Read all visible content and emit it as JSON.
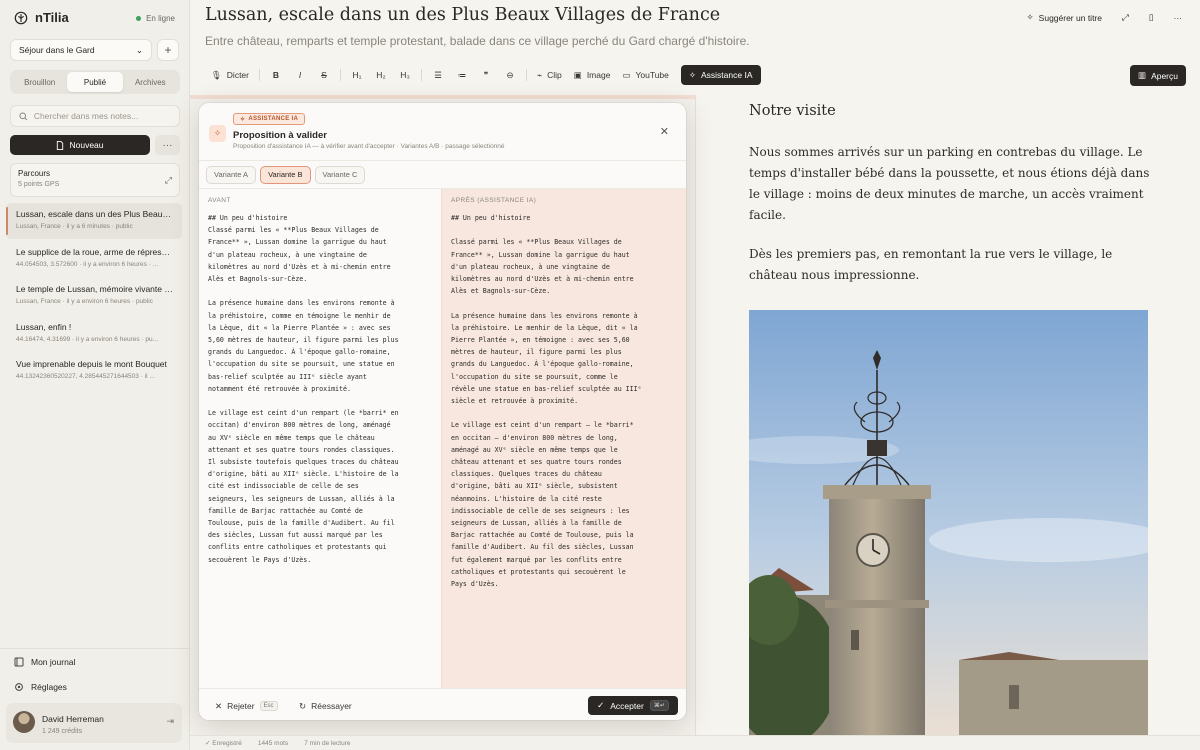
{
  "app": {
    "name": "nTilia",
    "status": "En ligne"
  },
  "sidebar": {
    "trip": "Séjour dans le Gard",
    "tabs": [
      {
        "label": "Brouillon",
        "active": false
      },
      {
        "label": "Publié",
        "active": true
      },
      {
        "label": "Archives",
        "active": false
      }
    ],
    "search_placeholder": "Chercher dans mes notes...",
    "new_label": "Nouveau",
    "parcours": {
      "title": "Parcours",
      "subtitle": "5 points GPS"
    },
    "notes": [
      {
        "title": "Lussan, escale dans un des Plus Beaux ...",
        "meta": "Lussan, France · il y a 6 minutes · public",
        "selected": true
      },
      {
        "title": "Le supplice de la roue, arme de répressi...",
        "meta": "44.054503, 3.572600 · il y a environ 6 heures · ...",
        "selected": false
      },
      {
        "title": "Le temple de Lussan, mémoire vivante d...",
        "meta": "Lussan, France · il y a environ 6 heures · public",
        "selected": false
      },
      {
        "title": "Lussan, enfin !",
        "meta": "44.16474, 4.31699 · il y a environ 6 heures · pu...",
        "selected": false
      },
      {
        "title": "Vue imprenable depuis le mont Bouquet",
        "meta": "44.13242360520227, 4.285445271644503 · il ...",
        "selected": false
      }
    ],
    "journal_label": "Mon journal",
    "settings_label": "Réglages",
    "user": {
      "name": "David Herreman",
      "credits": "1 249 crédits"
    }
  },
  "header": {
    "title": "Lussan, escale dans un des Plus Beaux Villages de France",
    "subtitle": "Entre château, remparts et temple protestant, balade dans ce village perché du Gard chargé d'histoire.",
    "suggest_label": "Suggérer un titre"
  },
  "toolbar": {
    "dictate": "Dicter",
    "bold": "B",
    "italic": "I",
    "strike": "S",
    "h1": "H₁",
    "h2": "H₂",
    "h3": "H₃",
    "clip": "Clip",
    "image": "Image",
    "youtube": "YouTube",
    "ai": "Assistance IA",
    "preview": "Aperçu"
  },
  "modal": {
    "badge": "ASSISTANCE IA",
    "title": "Proposition à valider",
    "subtitle": "Proposition d'assistance IA — à vérifier avant d'accepter · Variantes A/B · passage sélectionné",
    "variants": [
      {
        "label": "Variante A",
        "active": false
      },
      {
        "label": "Variante B",
        "active": true
      },
      {
        "label": "Variante C",
        "active": false
      }
    ],
    "before_label": "AVANT",
    "after_label": "APRÈS (ASSISTANCE IA)",
    "before_text": "## Un peu d'histoire\nClassé parmi les « **Plus Beaux Villages de\nFrance** », Lussan domine la garrigue du haut\nd'un plateau rocheux, à une vingtaine de\nkilomètres au nord d'Uzès et à mi-chemin entre\nAlès et Bagnols-sur-Cèze.\n\nLa présence humaine dans les environs remonte à\nla préhistoire, comme en témoigne le menhir de\nla Lèque, dit « la Pierre Plantée » : avec ses\n5,60 mètres de hauteur, il figure parmi les plus\ngrands du Languedoc. À l'époque gallo-romaine,\nl'occupation du site se poursuit, une statue en\nbas-relief sculptée au IIIᵉ siècle ayant\nnotamment été retrouvée à proximité.\n\nLe village est ceint d'un rempart (le *barri* en\noccitan) d'environ 800 mètres de long, aménagé\nau XVᵉ siècle en même temps que le château\nattenant et ses quatre tours rondes classiques.\nIl subsiste toutefois quelques traces du château\nd'origine, bâti au XIIᵉ siècle. L'histoire de la\ncité est indissociable de celle de ses\nseigneurs, les seigneurs de Lussan, alliés à la\nfamille de Barjac rattachée au Comté de\nToulouse, puis de la famille d'Audibert. Au fil\ndes siècles, Lussan fut aussi marqué par les\nconflits entre catholiques et protestants qui\nsecouèrent le Pays d'Uzès.",
    "after_text": "## Un peu d'histoire\n\nClassé parmi les « **Plus Beaux Villages de\nFrance** », Lussan domine la garrigue du haut\nd'un plateau rocheux, à une vingtaine de\nkilomètres au nord d'Uzès et à mi-chemin entre\nAlès et Bagnols-sur-Cèze.\n\nLa présence humaine dans les environs remonte à\nla préhistoire. Le menhir de la Lèque, dit « la\nPierre Plantée », en témoigne : avec ses 5,60\nmètres de hauteur, il figure parmi les plus\ngrands du Languedoc. À l'époque gallo-romaine,\nl'occupation du site se poursuit, comme le\nrévèle une statue en bas-relief sculptée au IIIᵉ\nsiècle et retrouvée à proximité.\n\nLe village est ceint d'un rempart — le *barri*\nen occitan — d'environ 800 mètres de long,\naménagé au XVᵉ siècle en même temps que le\nchâteau attenant et ses quatre tours rondes\nclassiques. Quelques traces du château\nd'origine, bâti au XIIᵉ siècle, subsistent\nnéanmoins. L'histoire de la cité reste\nindissociable de celle de ses seigneurs : les\nseigneurs de Lussan, alliés à la famille de\nBarjac rattachée au Comté de Toulouse, puis la\nfamille d'Audibert. Au fil des siècles, Lussan\nfut également marqué par les conflits entre\ncatholiques et protestants qui secouèrent le\nPays d'Uzès.",
    "reject_label": "Rejeter",
    "reject_key": "Esc",
    "retry_label": "Réessayer",
    "accept_label": "Accepter",
    "accept_key": "⌘↵"
  },
  "preview": {
    "heading": "Notre visite",
    "paragraph1": "Nous sommes arrivés sur un parking en contrebas du village. Le temps d'installer bébé dans la poussette, et nous étions déjà dans le village : moins de deux minutes de marche, un accès vraiment facile.",
    "paragraph2": "Dès les premiers pas, en remontant la rue vers le village, le château nous impressionne."
  },
  "statusbar": {
    "saved": "Enregistré",
    "words": "1445 mots",
    "reading": "7 min de lecture"
  },
  "colors": {
    "accent": "#c96a3f",
    "dark": "#2a2724",
    "online": "#3aa35b"
  }
}
